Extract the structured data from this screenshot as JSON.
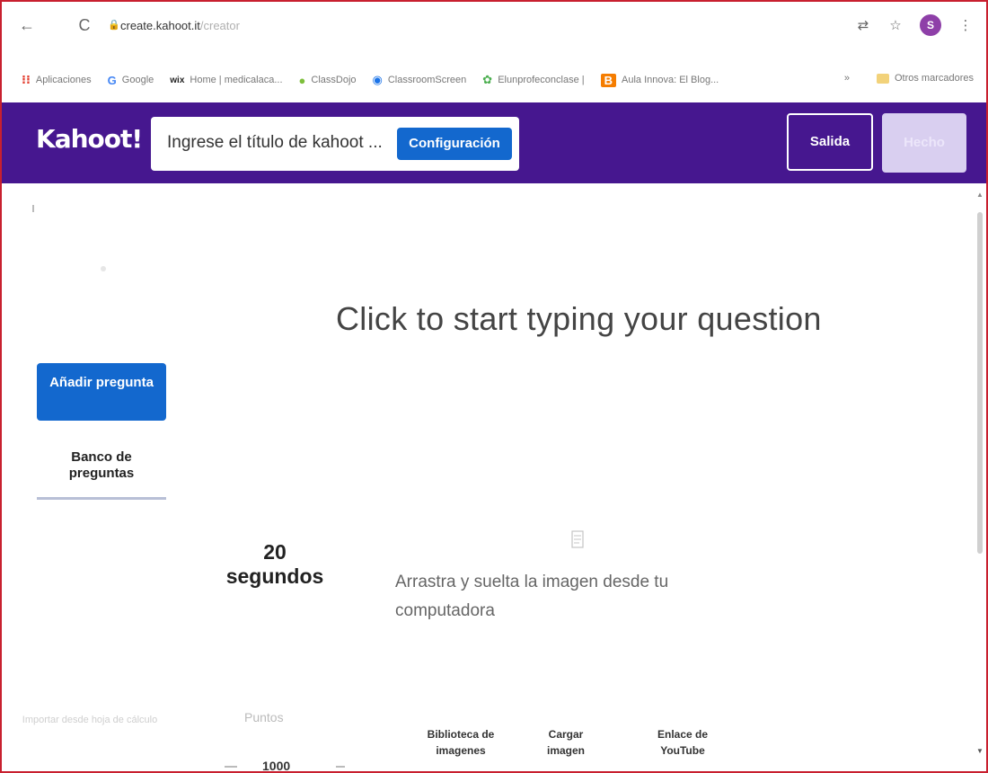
{
  "browser": {
    "url_domain": "create.kahoot.it",
    "url_path": "/creator",
    "profile_initial": "S",
    "bookmarks": [
      {
        "label": "Aplicaciones",
        "icon": "apps-grid-icon",
        "color": "#e34133"
      },
      {
        "label": "Google",
        "icon": "google-icon",
        "color": "#4285f4"
      },
      {
        "label": "Home | medicalaca...",
        "icon": "wix-icon",
        "color": "#222222"
      },
      {
        "label": "ClassDojo",
        "icon": "classdojo-icon",
        "color": "#7dbf3b"
      },
      {
        "label": "ClassroomScreen",
        "icon": "classroomscreen-icon",
        "color": "#1a73e8"
      },
      {
        "label": "Elunprofeconclase |",
        "icon": "leaf-icon",
        "color": "#4caf50"
      },
      {
        "label": "Aula Innova: El Blog...",
        "icon": "blogger-icon",
        "color": "#f57d00"
      }
    ],
    "bookmarks_more": "»",
    "other_bookmarks": "Otros marcadores"
  },
  "header": {
    "logo": "Kahoot!",
    "title_placeholder": "Ingrese el título de kahoot ...",
    "config_label": "Configuración",
    "exit_label": "Salida",
    "done_label": "Hecho",
    "brand_color": "#46178f",
    "accent_color": "#1368ce"
  },
  "sidebar": {
    "add_question": "Añadir pregunta",
    "question_bank": "Banco de preguntas",
    "bottom_label": "Importar desde hoja de cálculo"
  },
  "editor": {
    "question_placeholder": "Click to start typing your question",
    "time_value": "20",
    "time_unit": "segundos",
    "drop_text": "Arrastra y suelta la imagen desde tu computadora",
    "points_label": "Puntos",
    "points_value": "1000",
    "media_buttons": [
      "Biblioteca de imagenes",
      "Cargar imagen",
      "Enlace de YouTube"
    ]
  }
}
